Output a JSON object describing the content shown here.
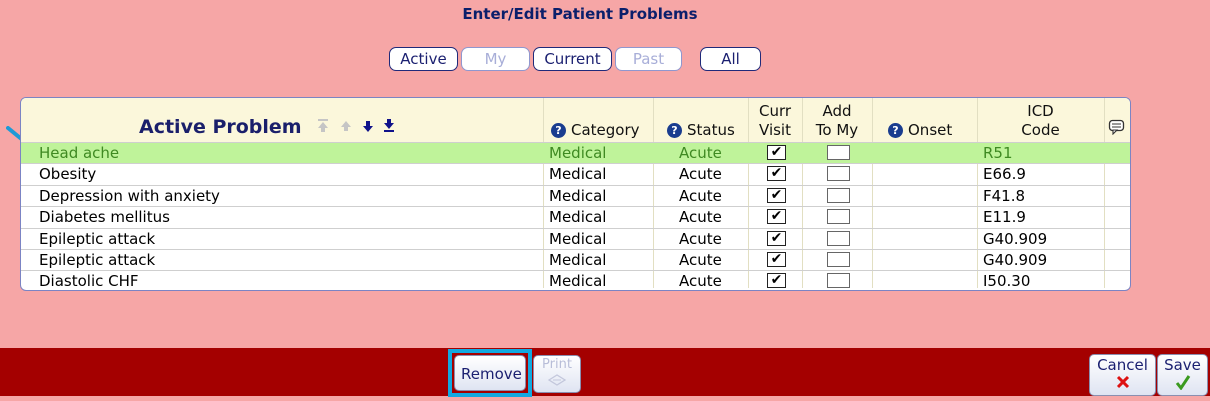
{
  "page_title": "Enter/Edit Patient Problems",
  "filters": {
    "active": "Active",
    "my": "My",
    "current": "Current",
    "past": "Past",
    "all": "All"
  },
  "table": {
    "headers": {
      "problem": "Active Problem",
      "category": "Category",
      "status": "Status",
      "curr_visit_1": "Curr",
      "curr_visit_2": "Visit",
      "add_to_my_1": "Add",
      "add_to_my_2": "To My",
      "onset": "Onset",
      "icd_1": "ICD",
      "icd_2": "Code"
    },
    "rows": [
      {
        "problem": "Head ache",
        "category": "Medical",
        "status": "Acute",
        "curr_visit": true,
        "add_to_my": false,
        "onset": "",
        "icd": "R51",
        "selected": true
      },
      {
        "problem": "Obesity",
        "category": "Medical",
        "status": "Acute",
        "curr_visit": true,
        "add_to_my": false,
        "onset": "",
        "icd": "E66.9",
        "selected": false
      },
      {
        "problem": "Depression with anxiety",
        "category": "Medical",
        "status": "Acute",
        "curr_visit": true,
        "add_to_my": false,
        "onset": "",
        "icd": "F41.8",
        "selected": false
      },
      {
        "problem": "Diabetes mellitus",
        "category": "Medical",
        "status": "Acute",
        "curr_visit": true,
        "add_to_my": false,
        "onset": "",
        "icd": "E11.9",
        "selected": false
      },
      {
        "problem": "Epileptic attack",
        "category": "Medical",
        "status": "Acute",
        "curr_visit": true,
        "add_to_my": false,
        "onset": "",
        "icd": "G40.909",
        "selected": false
      },
      {
        "problem": "Epileptic attack",
        "category": "Medical",
        "status": "Acute",
        "curr_visit": true,
        "add_to_my": false,
        "onset": "",
        "icd": "G40.909",
        "selected": false
      },
      {
        "problem": "Diastolic CHF",
        "category": "Medical",
        "status": "Acute",
        "curr_visit": true,
        "add_to_my": false,
        "onset": "",
        "icd": "I50.30",
        "selected": false
      }
    ]
  },
  "bottom_bar": {
    "remove": "Remove",
    "print": "Print",
    "cancel": "Cancel",
    "save": "Save"
  },
  "colors": {
    "background": "#f6a6a6",
    "bar": "#a40000",
    "selected_row": "#bff39a",
    "highlight": "#12a9e0"
  },
  "icons": [
    "help-icon",
    "move-top-icon",
    "move-up-icon",
    "move-down-icon",
    "move-bottom-icon",
    "comment-icon",
    "pointer-arrow-icon",
    "print-icon",
    "cancel-x-icon",
    "save-check-icon"
  ]
}
